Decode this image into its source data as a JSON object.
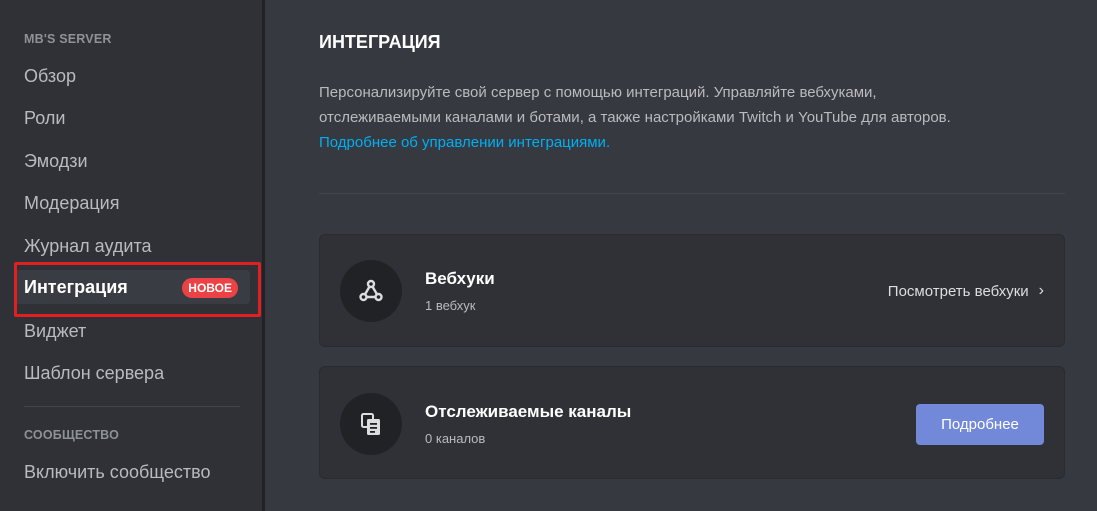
{
  "sidebar": {
    "server_header": "MB'S SERVER",
    "items": [
      {
        "label": "Обзор"
      },
      {
        "label": "Роли"
      },
      {
        "label": "Эмодзи"
      },
      {
        "label": "Модерация"
      },
      {
        "label": "Журнал аудита"
      },
      {
        "label": "Интеграция",
        "badge": "НОВОЕ",
        "active": true
      },
      {
        "label": "Виджет"
      },
      {
        "label": "Шаблон сервера"
      }
    ],
    "community_header": "СООБЩЕСТВО",
    "community_items": [
      {
        "label": "Включить сообщество"
      }
    ]
  },
  "main": {
    "title": "ИНТЕГРАЦИЯ",
    "description_line1": "Персонализируйте свой сервер с помощью интеграций. Управляйте вебхуками,",
    "description_line2": "отслеживаемыми каналами и ботами, а также настройками Twitch и YouTube для авторов.",
    "learn_more_link": "Подробнее об управлении интеграциями.",
    "cards": [
      {
        "icon": "webhook-icon",
        "title": "Вебхуки",
        "subtitle": "1 вебхук",
        "action": "Посмотреть вебхуки"
      },
      {
        "icon": "followed-channel-icon",
        "title": "Отслеживаемые каналы",
        "subtitle": "0 каналов",
        "button": "Подробнее"
      }
    ]
  },
  "colors": {
    "accent": "#7289da",
    "badge": "#ed4245",
    "link": "#00aff4",
    "highlight": "#e02020"
  }
}
